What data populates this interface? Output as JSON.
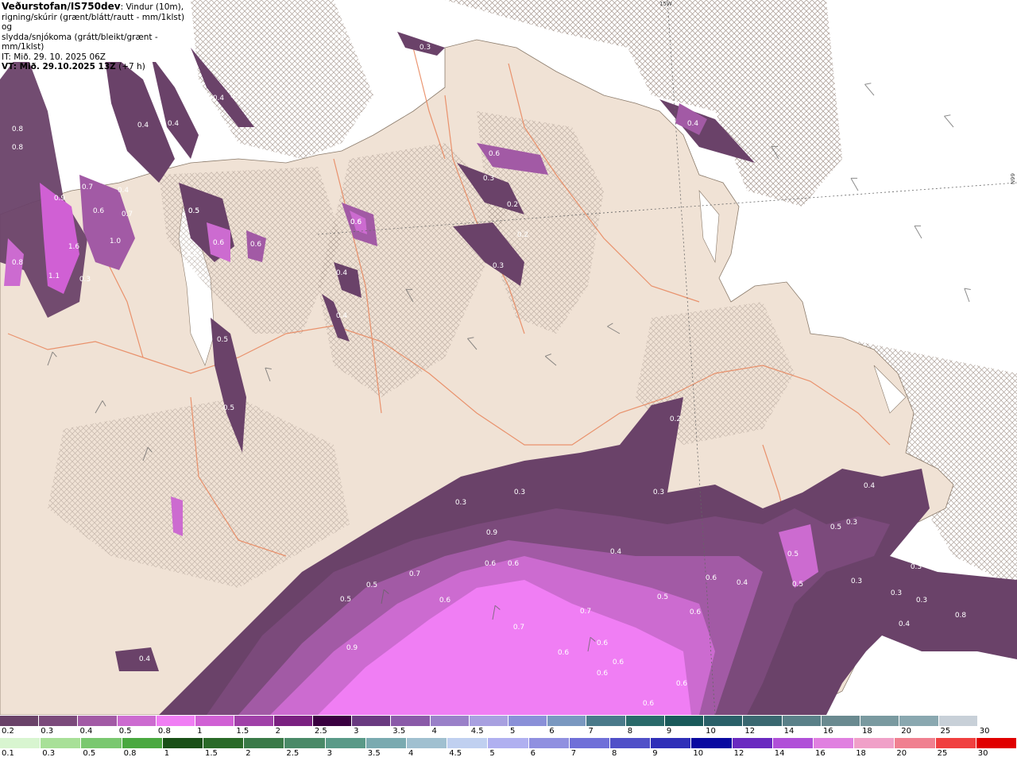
{
  "header": {
    "brand": "Veðurstofan/IS750dev",
    "line1_rest": ": Vindur (10m),",
    "line2": "rigning/skúrir (grænt/blátt/rautt - mm/1klst) og",
    "line3": "slydda/snjókoma (grátt/bleikt/grænt - mm/1klst)",
    "it": "IT: Mið. 29. 10. 2025 06Z",
    "vt": "VT: Mið. 29.10.2025 13Z",
    "vt_offset": "(+7 h)"
  },
  "coords": {
    "lon_top": "15W",
    "lat_right": "66N"
  },
  "colors": {
    "land": "#f0e2d5",
    "sea": "#ffffff",
    "roads": "#e8845a",
    "precip_02": "#6a4269",
    "precip_03": "#7b4a7b",
    "precip_05": "#a25aa5",
    "precip_06": "#cc6bd0",
    "precip_08": "#f07ef4"
  },
  "map_values": [
    "0.3",
    "0.3",
    "0.4",
    "0.3",
    "0.5",
    "0.4",
    "0.4",
    "0.4",
    "0.4",
    "0.8",
    "0.8",
    "0.5",
    "0.4",
    "0.4",
    "0.4",
    "0.9",
    "0.6",
    "0.7",
    "0.7",
    "1.0",
    "1.6",
    "1.1",
    "0.8",
    "0.3",
    "0.5",
    "0.6",
    "0.6",
    "0.5",
    "0.5",
    "0.5",
    "0.6",
    "0.4",
    "0.6",
    "0.3",
    "0.2",
    "0.2",
    "0.3",
    "0.2",
    "0.3",
    "0.3",
    "0.3",
    "0.4",
    "0.9",
    "0.6",
    "0.6",
    "0.5",
    "0.7",
    "0.5",
    "0.6",
    "0.9",
    "0.7",
    "0.6",
    "0.6",
    "0.6",
    "0.7",
    "0.5",
    "0.6",
    "0.6",
    "0.5",
    "0.6",
    "0.5",
    "0.5",
    "0.4",
    "0.4",
    "0.3",
    "0.3",
    "0.3",
    "0.3",
    "0.3",
    "0.4",
    "0.8",
    "0.6",
    "0.6",
    "0.4",
    "0.4",
    "0.5",
    "0.4",
    "0.6"
  ],
  "legend_snow": {
    "labels": [
      "0.2",
      "0.3",
      "0.4",
      "0.5",
      "0.8",
      "1",
      "1.5",
      "2",
      "2.5",
      "3",
      "3.5",
      "4",
      "4.5",
      "5",
      "6",
      "7",
      "8",
      "9",
      "10",
      "12",
      "14",
      "16",
      "18",
      "20",
      "25",
      "30"
    ],
    "colors": [
      "#6a4269",
      "#7b4a7b",
      "#a25aa5",
      "#cc6bd0",
      "#f07ef4",
      "#d060d4",
      "#a040a8",
      "#7a2080",
      "#3a0040",
      "#6a3a80",
      "#8a5aa8",
      "#9a80c8",
      "#a8a0e0",
      "#8a90d8",
      "#7a98c0",
      "#4a7a8a",
      "#2a6a6a",
      "#1a5a5a",
      "#2a6068",
      "#3a6870",
      "#5a8088",
      "#6a8a90",
      "#7a9aa0",
      "#8aa8b0",
      "#c8d0d8",
      "#ffffff"
    ]
  },
  "legend_rain": {
    "labels": [
      "0.1",
      "0.3",
      "0.5",
      "0.8",
      "1",
      "1.5",
      "2",
      "2.5",
      "3",
      "3.5",
      "4",
      "4.5",
      "5",
      "6",
      "7",
      "8",
      "9",
      "10",
      "12",
      "14",
      "16",
      "18",
      "20",
      "25",
      "30"
    ],
    "colors": [
      "#d8f5d0",
      "#a8e098",
      "#7ac870",
      "#4aa840",
      "#1a5018",
      "#2a6a28",
      "#3a7a48",
      "#4a8a68",
      "#5a9a88",
      "#7aaab0",
      "#a0c0d0",
      "#c0d0f0",
      "#b0b0f0",
      "#9090e0",
      "#7070d8",
      "#5050c8",
      "#3030b8",
      "#0a0aa0",
      "#6a2ac0",
      "#b050d8",
      "#e080e0",
      "#f0a0c8",
      "#f08090",
      "#f04040",
      "#e00000"
    ]
  }
}
